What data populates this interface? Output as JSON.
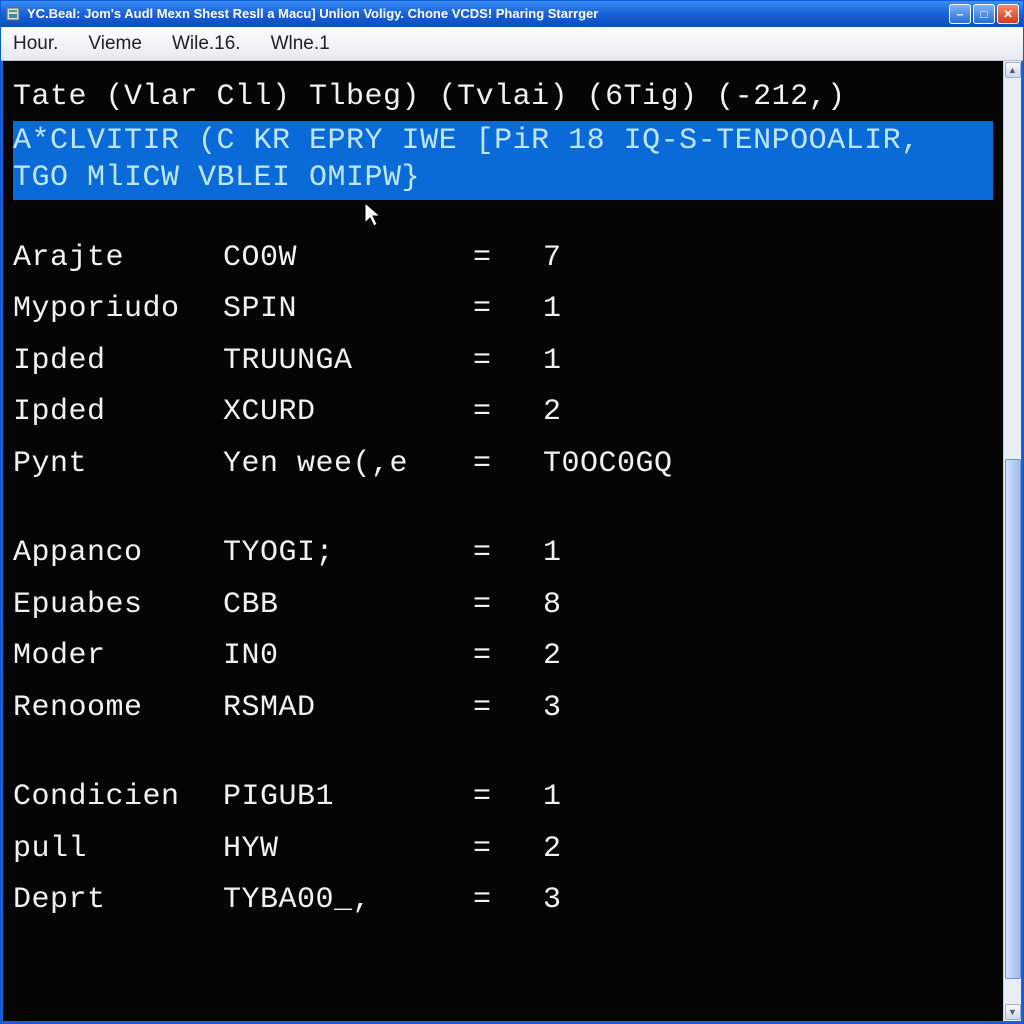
{
  "titlebar": {
    "text": "YC.Beal: Jom's Audl Mexn Shest Resll a Macu] Unlion Voligy. Chone VCDS! Pharing Starrger"
  },
  "menubar": {
    "items": [
      "Hour.",
      "Vieme",
      "Wile.16.",
      "Wlne.1"
    ]
  },
  "terminal": {
    "header": "Tate (Vlar Cll) Tlbeg) (Tvlai) (6Tig) (-212,)",
    "highlight": "A*CLVITIR (C KR EPRY IWE [PiR 18 IQ-S-TENPOOALIR,\nTGO MlICW VBLEI OMIPW}",
    "groups": [
      [
        {
          "c1": "Arajte",
          "c2": "CO0W",
          "val": "7"
        },
        {
          "c1": "Myporiudo",
          "c2": "SPIN",
          "val": "1"
        },
        {
          "c1": "Ipded",
          "c2": "TRUUNGA",
          "val": "1"
        },
        {
          "c1": "Ipded",
          "c2": "XCURD",
          "val": "2"
        },
        {
          "c1": "Pynt",
          "c2": "Yen wee(,e",
          "val": "T0OC0GQ"
        }
      ],
      [
        {
          "c1": "Appanco",
          "c2": "TYOGI;",
          "val": "1"
        },
        {
          "c1": "Epuabes",
          "c2": "CBB",
          "val": "8"
        },
        {
          "c1": "Moder",
          "c2": "IN0",
          "val": "2"
        },
        {
          "c1": "Renoome",
          "c2": "RSMAD",
          "val": "3"
        }
      ],
      [
        {
          "c1": "Condicien",
          "c2": "PIGUB1",
          "val": "1"
        },
        {
          "c1": "pull",
          "c2": "HYW",
          "val": "2"
        },
        {
          "c1": "Deprt",
          "c2": "TYBA00_,",
          "val": "3"
        }
      ]
    ]
  },
  "window_controls": {
    "minimize": "–",
    "maximize": "□",
    "close": "✕"
  },
  "scroll": {
    "up": "▲",
    "down": "▼"
  }
}
